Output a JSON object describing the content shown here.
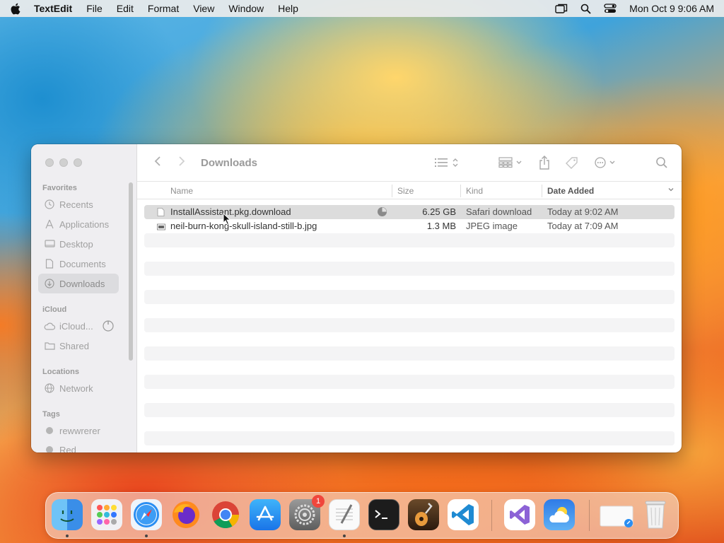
{
  "menubar": {
    "app_name": "TextEdit",
    "menus": [
      "File",
      "Edit",
      "Format",
      "View",
      "Window",
      "Help"
    ],
    "clock": "Mon Oct 9  9:06 AM",
    "status_icons": [
      "screen-mirroring-icon",
      "spotlight-search-icon",
      "control-center-icon"
    ]
  },
  "finder": {
    "title": "Downloads",
    "sidebar": {
      "favorites_heading": "Favorites",
      "favorites": [
        "Recents",
        "Applications",
        "Desktop",
        "Documents",
        "Downloads"
      ],
      "active_item": "Downloads",
      "icloud_heading": "iCloud",
      "icloud": [
        "iCloud...",
        "Shared"
      ],
      "locations_heading": "Locations",
      "locations": [
        "Network"
      ],
      "tags_heading": "Tags",
      "tags": [
        "rewwrerer",
        "Red"
      ]
    },
    "columns": {
      "name": "Name",
      "size": "Size",
      "kind": "Kind",
      "date_added": "Date Added"
    },
    "files": [
      {
        "name": "InstallAssistant.pkg.download",
        "size": "6.25 GB",
        "kind": "Safari download",
        "date_added": "Today at 9:02 AM",
        "selected": true,
        "icon": "document-icon"
      },
      {
        "name": "neil-burn-kong-skull-island-still-b.jpg",
        "size": "1.3 MB",
        "kind": "JPEG image",
        "date_added": "Today at 7:09 AM",
        "selected": false,
        "icon": "image-file-icon"
      }
    ]
  },
  "dock": {
    "apps": [
      "Finder",
      "Launchpad",
      "Safari",
      "Firefox",
      "Chrome",
      "App Store",
      "System Settings",
      "TextEdit",
      "Terminal",
      "GarageBand",
      "Visual Studio Code",
      "Visual Studio",
      "Weather",
      "Downloads",
      "Trash"
    ],
    "settings_badge": "1"
  }
}
